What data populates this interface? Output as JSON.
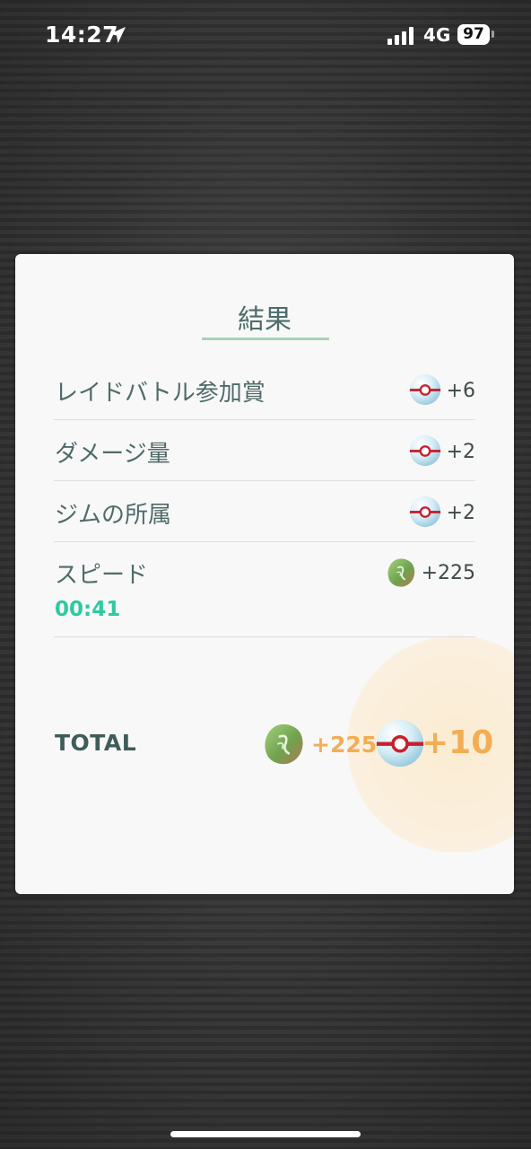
{
  "status_bar": {
    "time": "14:27",
    "network": "4G",
    "battery": "97"
  },
  "result": {
    "title": "結果",
    "rows": [
      {
        "label": "レイドバトル参加賞",
        "reward_icon": "premier-ball-icon",
        "value": "+6"
      },
      {
        "label": "ダメージ量",
        "reward_icon": "premier-ball-icon",
        "value": "+2"
      },
      {
        "label": "ジムの所属",
        "reward_icon": "premier-ball-icon",
        "value": "+2"
      },
      {
        "label": "スピード",
        "sublabel": "00:41",
        "reward_icon": "rare-candy-icon",
        "value": "+225"
      }
    ],
    "total": {
      "label": "TOTAL",
      "candy_value": "+225",
      "ball_value": "+10"
    }
  },
  "colors": {
    "accent_green": "#2ecaa0",
    "reward_orange": "#f2ae55",
    "title_teal": "#4d6d6a"
  }
}
